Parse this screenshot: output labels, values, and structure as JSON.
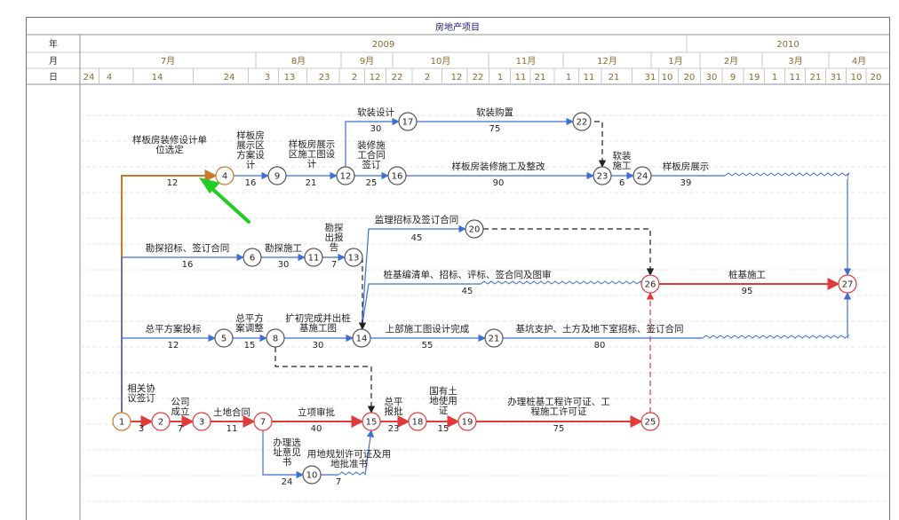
{
  "title": "房地产项目",
  "header": {
    "row_labels": [
      "年",
      "月",
      "日"
    ],
    "years": [
      "2009",
      "2010"
    ],
    "months": [
      "7月",
      "8月",
      "9月",
      "10月",
      "11月",
      "12月",
      "1月",
      "2月",
      "3月",
      "4月"
    ],
    "days": [
      "24",
      "4",
      "14",
      "24",
      "3",
      "13",
      "23",
      "2",
      "12",
      "22",
      "2",
      "12",
      "22",
      "1",
      "11",
      "21",
      "1",
      "11",
      "21",
      "31",
      "10",
      "20",
      "30",
      "9",
      "19",
      "1",
      "11",
      "21",
      "31",
      "10",
      "20"
    ]
  },
  "colors": {
    "critical": "#e03a3a",
    "normal": "#3d6fd6",
    "highlight": "#c8782a",
    "arrow": "#22cc22",
    "title_text": "#1a1a8c",
    "header_text": "#8a6a2a"
  },
  "nodes": [
    "1",
    "2",
    "3",
    "4",
    "5",
    "6",
    "7",
    "8",
    "9",
    "10",
    "11",
    "12",
    "13",
    "14",
    "15",
    "16",
    "17",
    "18",
    "19",
    "20",
    "21",
    "22",
    "23",
    "24",
    "25",
    "26",
    "27"
  ],
  "activities": [
    {
      "id": "a1",
      "from": "1",
      "to": "2",
      "name": "相关协议签订",
      "duration": "3",
      "kind": "critical"
    },
    {
      "id": "a2",
      "from": "2",
      "to": "3",
      "name": "公司成立",
      "duration": "7",
      "kind": "critical"
    },
    {
      "id": "a3",
      "from": "3",
      "to": "7",
      "name": "土地合同",
      "duration": "11",
      "kind": "critical"
    },
    {
      "id": "a4",
      "from": "7",
      "to": "15",
      "name": "立项审批",
      "duration": "40",
      "kind": "critical"
    },
    {
      "id": "a5",
      "from": "15",
      "to": "18",
      "name": "总平报批",
      "duration": "23",
      "kind": "critical"
    },
    {
      "id": "a6",
      "from": "18",
      "to": "19",
      "name": "国有土地使用证",
      "duration": "15",
      "kind": "critical"
    },
    {
      "id": "a7",
      "from": "19",
      "to": "25",
      "name": "办理桩基工程许可证、工程施工许可证",
      "duration": "75",
      "kind": "critical"
    },
    {
      "id": "a8",
      "from": "26",
      "to": "27",
      "name": "桩基施工",
      "duration": "95",
      "kind": "critical"
    },
    {
      "id": "a9",
      "from": "1",
      "to": "4",
      "name": "样板房装修设计单位选定",
      "duration": "12",
      "kind": "highlight"
    },
    {
      "id": "a10",
      "from": "4",
      "to": "9",
      "name": "样板房展示区方案设计",
      "duration": "16",
      "kind": "normal"
    },
    {
      "id": "a11",
      "from": "9",
      "to": "12",
      "name": "样板房展示区施工图设计",
      "duration": "21",
      "kind": "normal"
    },
    {
      "id": "a12",
      "from": "12",
      "to": "16",
      "name": "装修施工合同签订",
      "duration": "25",
      "kind": "normal"
    },
    {
      "id": "a13",
      "from": "16",
      "to": "23",
      "name": "样板房装修施工及整改",
      "duration": "90",
      "kind": "normal"
    },
    {
      "id": "a14",
      "from": "12",
      "to": "17",
      "name": "软装设计",
      "duration": "30",
      "kind": "normal"
    },
    {
      "id": "a15",
      "from": "17",
      "to": "22",
      "name": "软装购置",
      "duration": "75",
      "kind": "normal"
    },
    {
      "id": "a16",
      "from": "23",
      "to": "24",
      "name": "软装施工",
      "duration": "6",
      "kind": "normal"
    },
    {
      "id": "a17",
      "from": "24",
      "to": "27",
      "name": "样板房展示",
      "duration": "39",
      "kind": "normal"
    },
    {
      "id": "a18",
      "from": "1",
      "to": "6",
      "name": "勘探招标、签订合同",
      "duration": "16",
      "kind": "normal"
    },
    {
      "id": "a19",
      "from": "6",
      "to": "11",
      "name": "勘探施工",
      "duration": "30",
      "kind": "normal"
    },
    {
      "id": "a20",
      "from": "11",
      "to": "13",
      "name": "勘探出报告",
      "duration": "7",
      "kind": "normal"
    },
    {
      "id": "a21",
      "from": "14",
      "to": "20",
      "name": "监理招标及签订合同",
      "duration": "45",
      "kind": "normal"
    },
    {
      "id": "a22",
      "from": "14",
      "to": "26",
      "name": "桩基编清单、招标、评标、签合同及图审",
      "duration": "45",
      "kind": "normal"
    },
    {
      "id": "a23",
      "from": "1",
      "to": "5",
      "name": "总平方案投标",
      "duration": "12",
      "kind": "normal"
    },
    {
      "id": "a24",
      "from": "5",
      "to": "8",
      "name": "总平方案调整",
      "duration": "15",
      "kind": "normal"
    },
    {
      "id": "a25",
      "from": "8",
      "to": "14",
      "name": "扩初完成并出桩基施工图",
      "duration": "30",
      "kind": "normal"
    },
    {
      "id": "a26",
      "from": "14",
      "to": "21",
      "name": "上部施工图设计完成",
      "duration": "55",
      "kind": "normal"
    },
    {
      "id": "a27",
      "from": "21",
      "to": "27",
      "name": "基坑支护、土方及地下室招标、签订合同",
      "duration": "80",
      "kind": "normal"
    },
    {
      "id": "a28",
      "from": "7",
      "to": "10",
      "name": "办理选址意见书",
      "duration": "24",
      "kind": "normal"
    },
    {
      "id": "a29",
      "from": "10",
      "to": "15",
      "name": "用地规划许可证及用地批准书",
      "duration": "7",
      "kind": "normal"
    }
  ]
}
